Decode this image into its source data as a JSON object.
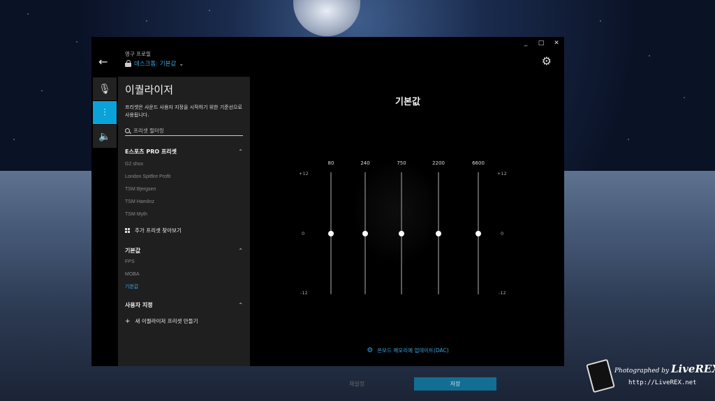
{
  "window": {
    "controls": [
      "_",
      "□",
      "✕"
    ]
  },
  "header": {
    "back_icon": "←",
    "profile_caption": "영구 프로필",
    "profile_name": "데스크톱: 기본값",
    "chevron": "⌄",
    "settings_icon": "⚙"
  },
  "rail": [
    {
      "name": "microphone",
      "icon": "🎙",
      "active": false
    },
    {
      "name": "equalizer",
      "icon": "⫶",
      "active": true
    },
    {
      "name": "speaker",
      "icon": "🔈",
      "active": false
    }
  ],
  "panel": {
    "title": "이퀄라이저",
    "description": "프리셋은 사운드 사용자 지정을 시작하기 위한 기준선으로 사용됩니다.",
    "search_placeholder": "프리셋 필터링",
    "esports_header": "E스포츠 PRO 프리셋",
    "esports_items": [
      "G2 shox",
      "London Spitfire Profit",
      "TSM Bjergsen",
      "TSM Hamlinz",
      "TSM Myth"
    ],
    "browse_label": "추가 프리셋 찾아보기",
    "default_header": "기본값",
    "default_items": [
      "FPS",
      "MOBA",
      "기본값"
    ],
    "default_selected": "기본값",
    "custom_header": "사용자 지정",
    "create_label": "새 이퀄라이저 프리셋 만들기",
    "caret": "⌃"
  },
  "eq": {
    "title": "기본값",
    "bands": [
      "80",
      "240",
      "750",
      "2200",
      "6600"
    ],
    "gains_db": [
      0,
      0,
      0,
      0,
      0
    ],
    "scale_top": "+12",
    "scale_mid": "0",
    "scale_bottom": "-12",
    "range_db": [
      -12,
      12
    ]
  },
  "footer": {
    "dac_label": "온보드 메모리에 업데이트(DAC)",
    "reset_label": "재설정",
    "save_label": "저장"
  },
  "watermark": {
    "line1_prefix": "Photographed by ",
    "line1_brand": "LiveREX",
    "line2": "http://LiveREX.net"
  },
  "colors": {
    "accent": "#0aa3d9",
    "save_bg": "#126e92",
    "panel_bg": "#1f1f1f",
    "window_bg": "#000000"
  }
}
